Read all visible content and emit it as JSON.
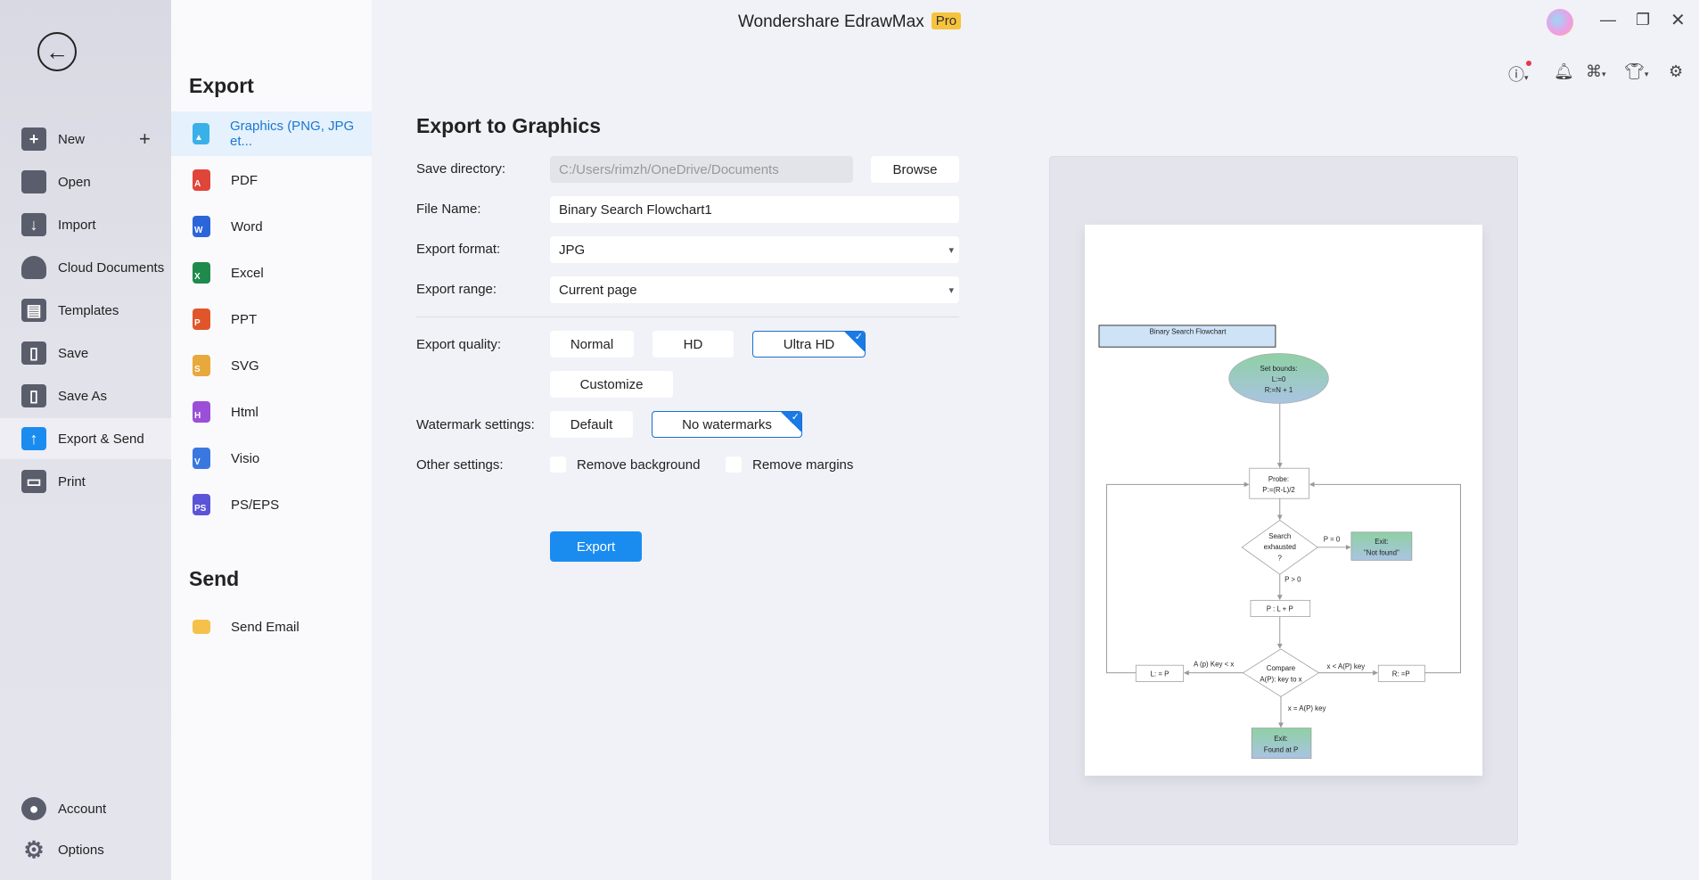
{
  "window": {
    "title": "Wondershare EdrawMax",
    "badge": "Pro"
  },
  "sidebar": {
    "items": [
      {
        "label": "New",
        "icon": "plus-square-icon"
      },
      {
        "label": "Open",
        "icon": "folder-icon"
      },
      {
        "label": "Import",
        "icon": "import-icon"
      },
      {
        "label": "Cloud Documents",
        "icon": "cloud-icon"
      },
      {
        "label": "Templates",
        "icon": "templates-icon"
      },
      {
        "label": "Save",
        "icon": "save-icon"
      },
      {
        "label": "Save As",
        "icon": "save-as-icon"
      },
      {
        "label": "Export & Send",
        "icon": "export-icon",
        "active": true
      },
      {
        "label": "Print",
        "icon": "print-icon"
      }
    ],
    "bottom": [
      {
        "label": "Account",
        "icon": "account-icon"
      },
      {
        "label": "Options",
        "icon": "gear-icon"
      }
    ]
  },
  "export_panel": {
    "heading": "Export",
    "items": [
      {
        "label": "Graphics (PNG, JPG et...",
        "color": "#3ab0e8",
        "glyph": "▲"
      },
      {
        "label": "PDF",
        "color": "#e0453a",
        "glyph": "A"
      },
      {
        "label": "Word",
        "color": "#2b65d9",
        "glyph": "W"
      },
      {
        "label": "Excel",
        "color": "#1e8a4c",
        "glyph": "X"
      },
      {
        "label": "PPT",
        "color": "#e0562a",
        "glyph": "P"
      },
      {
        "label": "SVG",
        "color": "#e8a83a",
        "glyph": "S"
      },
      {
        "label": "Html",
        "color": "#9b4fd8",
        "glyph": "H"
      },
      {
        "label": "Visio",
        "color": "#3a78e0",
        "glyph": "V"
      },
      {
        "label": "PS/EPS",
        "color": "#5a55d8",
        "glyph": "PS"
      }
    ],
    "send_heading": "Send",
    "send_items": [
      {
        "label": "Send Email",
        "color": "#f5c14a"
      }
    ]
  },
  "form": {
    "title": "Export to Graphics",
    "save_directory": {
      "label": "Save directory:",
      "value": "C:/Users/rimzh/OneDrive/Documents",
      "browse": "Browse"
    },
    "file_name": {
      "label": "File Name:",
      "value": "Binary Search Flowchart1"
    },
    "export_format": {
      "label": "Export format:",
      "value": "JPG"
    },
    "export_range": {
      "label": "Export range:",
      "value": "Current page"
    },
    "quality": {
      "label": "Export quality:",
      "options": [
        "Normal",
        "HD",
        "Ultra HD",
        "Customize"
      ],
      "selected": "Ultra HD"
    },
    "watermark": {
      "label": "Watermark settings:",
      "options": [
        "Default",
        "No watermarks"
      ],
      "selected": "No watermarks"
    },
    "other": {
      "label": "Other settings:",
      "remove_background": "Remove background",
      "remove_margins": "Remove margins",
      "remove_background_checked": false,
      "remove_margins_checked": false
    },
    "export_button": "Export"
  },
  "flowchart": {
    "title": "Binary Search Flowchart",
    "start": [
      "Set bounds:",
      "L:=0",
      "R:=N + 1"
    ],
    "probe": [
      "Probe:",
      "P:=(R-L)/2"
    ],
    "exhausted": [
      "Search",
      "exhausted",
      "?"
    ],
    "p_zero": "P = 0",
    "exit_not_found": [
      "Exit:",
      "\"Not found\""
    ],
    "p_gt_zero": "P > 0",
    "step": "P : L + P",
    "compare": [
      "Compare",
      "A(P): key to x"
    ],
    "left_label": "A (p) Key < x",
    "left_box": "L: = P",
    "right_label": "x < A(P) key",
    "right_box": "R: =P",
    "equal_label": "x = A(P) key",
    "exit_found": [
      "Exit:",
      "Found at P"
    ]
  }
}
